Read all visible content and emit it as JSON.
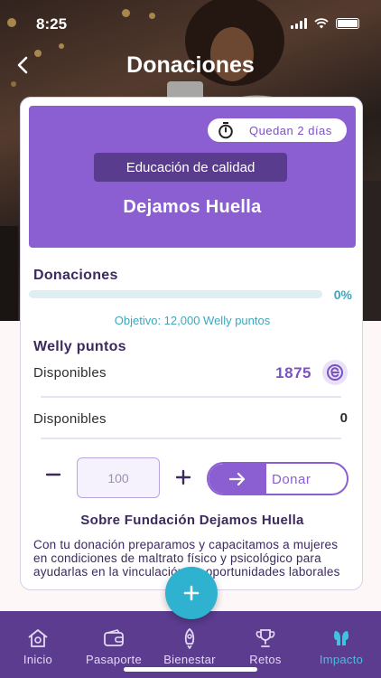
{
  "status_bar": {
    "time": "8:25"
  },
  "header": {
    "title": "Donaciones",
    "back_icon": "chevron-left-icon"
  },
  "banner": {
    "background": "#8b5fd1",
    "timer_icon": "stopwatch-icon",
    "time_remaining": "Quedan 2 días",
    "category": "Educación de calidad",
    "organization": "Dejamos Huella"
  },
  "donations": {
    "label": "Donaciones",
    "progress": 0.0,
    "percent_text": "0%",
    "goal_text": "Objetivo: 12,000 Welly puntos"
  },
  "welly": {
    "label": "Welly puntos",
    "available_label": "Disponibles",
    "available_points": "1875",
    "coin_icon": "welly-coin-icon",
    "second_label": "Disponibles",
    "second_value": "0"
  },
  "donate_form": {
    "quantity_placeholder": "100",
    "donate_label": "Donar"
  },
  "about": {
    "title": "Sobre Fundación Dejamos Huella",
    "text": "Con tu donación preparamos y capacitamos a mujeres en condiciones de maltrato físico y psicológico para ayudarlas en la vinculación de oportunidades laborales"
  },
  "tabbar": {
    "items": [
      {
        "label": "Inicio",
        "icon": "home-icon"
      },
      {
        "label": "Pasaporte",
        "icon": "wallet-icon"
      },
      {
        "label": "Bienestar",
        "icon": "rocket-icon"
      },
      {
        "label": "Retos",
        "icon": "trophy-icon"
      },
      {
        "label": "Impacto",
        "icon": "impact-icon",
        "active": true
      }
    ]
  },
  "colors": {
    "primary": "#8b5fd1",
    "accent": "#2fb1d0",
    "tabbar": "#5b3c8f",
    "dark_text": "#3c2a5e"
  }
}
